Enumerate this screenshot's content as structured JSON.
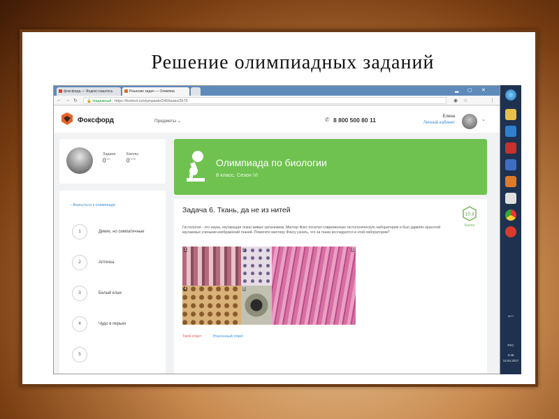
{
  "slide": {
    "title": "Решение олимпиадных заданий"
  },
  "browser": {
    "tabs": [
      {
        "label": "фоксфорд — Яндекс:нашлось",
        "favicon_color": "#e83a2c"
      },
      {
        "label": "Решение задач — Олимпиа",
        "favicon_color": "#e26b1f"
      }
    ],
    "window_controls": [
      "▂",
      "▢",
      "✕"
    ],
    "secure_label": "Надежный",
    "url": "https://foxford.ru/olympiads/245/tasks/2675"
  },
  "site": {
    "logo_text": "Фоксфорд",
    "nav_subjects": "Предметы",
    "phone": "8 800 500 80 11",
    "user_name": "Елена",
    "cabinet_link": "Личный кабинет"
  },
  "profile": {
    "tasks_label": "Задачи",
    "tasks_value": "0",
    "tasks_max": "/10",
    "points_label": "Баллы",
    "points_value": "0",
    "points_max": "/100"
  },
  "sidebar": {
    "back_link": "Вернуться к олимпиаде",
    "tasks": [
      {
        "num": "1",
        "title": "Дикие, но симпатичные"
      },
      {
        "num": "2",
        "title": "Аптечка"
      },
      {
        "num": "3",
        "title": "Белый клык"
      },
      {
        "num": "4",
        "title": "Чудо в перьях"
      },
      {
        "num": "5",
        "title": ""
      }
    ]
  },
  "olympiad": {
    "title": "Олимпиада по биологии",
    "subtitle": "8 класс, Сезон VI"
  },
  "task": {
    "heading": "Задача 6. Ткань, да не из нитей",
    "score": "10.3",
    "score_label": "Балла",
    "text": "Гистология - это наука, изучающая ткани живых организмов. Мистер Фокс посетил современную гистологическую лабораторию и был удивлён красотой изучаемых учеными изображений тканей. Помогите мистеру Фоксу узнать, что за ткани исследуются в этой лаборатории?",
    "image_numbers": [
      "1",
      "2",
      "3",
      "4",
      "5"
    ],
    "my_answer": "Твой ответ",
    "reference_answer": "Эталонный ответ"
  },
  "taskbar": {
    "lang": "РУС",
    "time": "3:46",
    "date": "14.04.2017"
  },
  "colors": {
    "accent_green": "#6fc24f",
    "link_blue": "#3b8fd6",
    "frame_brown": "#6b3a15"
  }
}
